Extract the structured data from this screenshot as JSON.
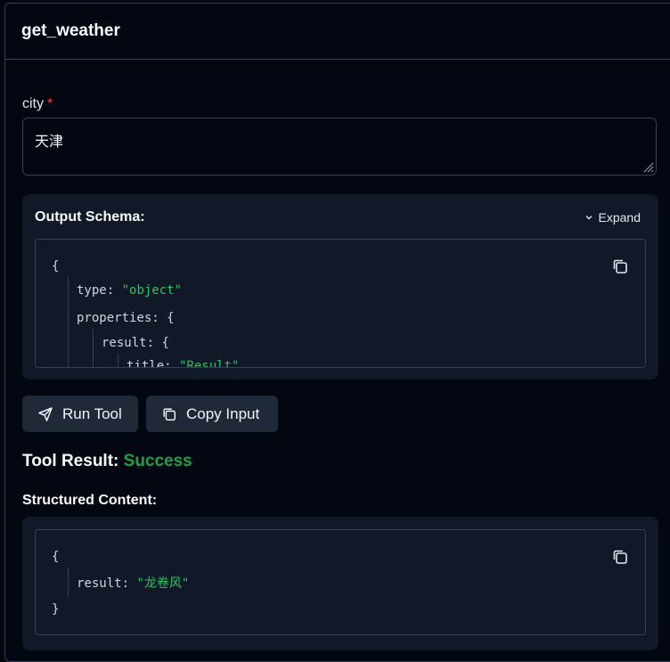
{
  "header": {
    "title": "get_weather"
  },
  "form": {
    "city_label": "city",
    "required_mark": "*",
    "city_value": "天津"
  },
  "schema": {
    "title": "Output Schema:",
    "expand_label": "Expand",
    "lines": {
      "open": "{",
      "type_key": "type:",
      "type_val": "\"object\"",
      "props_key": "properties:",
      "props_brace": "{",
      "result_key": "result:",
      "result_brace": "{",
      "title_key": "title:",
      "title_val": "\"Result\""
    }
  },
  "actions": {
    "run_label": "Run Tool",
    "copy_label": "Copy Input"
  },
  "result": {
    "heading": "Tool Result:",
    "status": "Success",
    "status_color": "#16a34a",
    "structured_label": "Structured Content:",
    "lines": {
      "open": "{",
      "key": "result:",
      "value": "\"龙卷风\"",
      "close": "}"
    }
  },
  "icons": {
    "copy": "copy-icon",
    "chevron": "chevron-down-icon",
    "send": "send-icon",
    "resize": "resize-handle-icon"
  }
}
